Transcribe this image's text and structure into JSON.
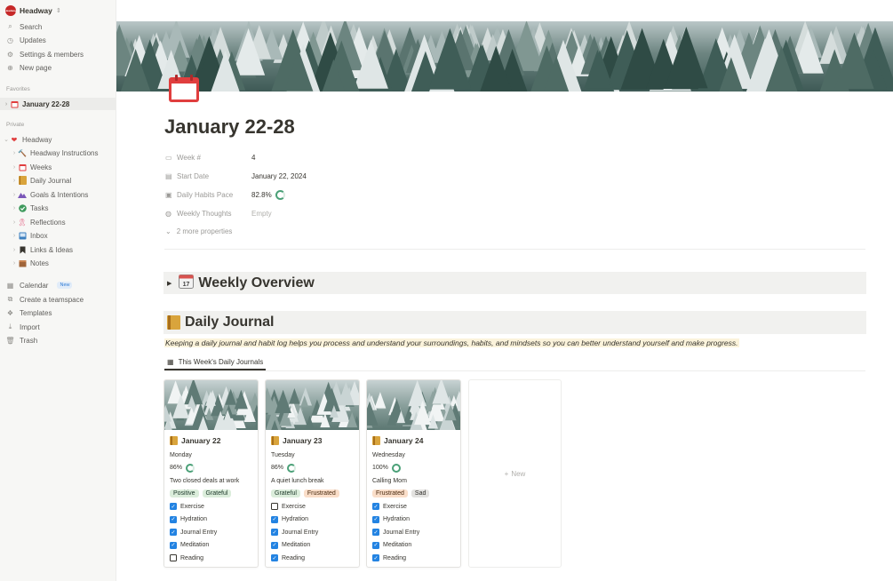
{
  "sidebar": {
    "workspace": "Headway",
    "workspace_logo": "Headway",
    "top": [
      {
        "label": "Search",
        "icon": "search-icon"
      },
      {
        "label": "Updates",
        "icon": "clock-icon"
      },
      {
        "label": "Settings & members",
        "icon": "gear-icon"
      },
      {
        "label": "New page",
        "icon": "plus-circle-icon"
      }
    ],
    "favorites_label": "Favorites",
    "favorites": [
      {
        "label": "January 22-28",
        "icon": "calendar-icon"
      }
    ],
    "private_label": "Private",
    "private_root": {
      "label": "Headway",
      "icon": "heart-icon"
    },
    "private_children": [
      {
        "label": "Headway Instructions",
        "icon": "hammer-icon"
      },
      {
        "label": "Weeks",
        "icon": "calendar-icon"
      },
      {
        "label": "Daily Journal",
        "icon": "journal-icon"
      },
      {
        "label": "Goals & Intentions",
        "icon": "mountain-icon"
      },
      {
        "label": "Tasks",
        "icon": "check-circle-icon"
      },
      {
        "label": "Reflections",
        "icon": "ribbon-icon"
      },
      {
        "label": "Inbox",
        "icon": "inbox-icon"
      },
      {
        "label": "Links & Ideas",
        "icon": "bookmark-icon"
      },
      {
        "label": "Notes",
        "icon": "box-icon"
      }
    ],
    "bottom": [
      {
        "label": "Calendar",
        "icon": "calendar-grid-icon",
        "badge": "New"
      },
      {
        "label": "Create a teamspace",
        "icon": "teamspace-icon"
      },
      {
        "label": "Templates",
        "icon": "templates-icon"
      },
      {
        "label": "Import",
        "icon": "import-icon"
      },
      {
        "label": "Trash",
        "icon": "trash-icon"
      }
    ]
  },
  "page": {
    "title": "January 22-28",
    "properties": [
      {
        "label": "Week #",
        "value": "4",
        "icon": "calendar-icon"
      },
      {
        "label": "Start Date",
        "value": "January 22, 2024",
        "icon": "date-icon"
      },
      {
        "label": "Daily Habits Pace",
        "value": "82.8%",
        "icon": "formula-icon"
      },
      {
        "label": "Weekly Thoughts",
        "value": "Empty",
        "icon": "rollup-icon"
      }
    ],
    "more_properties": "2 more properties",
    "weekly_overview": {
      "title": "Weekly Overview",
      "icon": "calendar-emoji-icon"
    },
    "daily_journal": {
      "title": "Daily Journal",
      "description": "Keeping a daily journal and habit log helps you process and understand your surroundings, habits, and mindsets so you can better understand yourself and make progress.",
      "view_tab": "This Week's Daily Journals",
      "new_label": "New"
    }
  },
  "cards": [
    {
      "title": "January 22",
      "day": "Monday",
      "pct": "86%",
      "pct_value": 0.86,
      "note": "Two closed deals at work",
      "tags": [
        {
          "label": "Positive",
          "bg": "#dbeddb",
          "fg": "#1c3829"
        },
        {
          "label": "Grateful",
          "bg": "#dbeddb",
          "fg": "#1c3829"
        }
      ],
      "habits": [
        {
          "label": "Exercise",
          "checked": true
        },
        {
          "label": "Hydration",
          "checked": true
        },
        {
          "label": "Journal Entry",
          "checked": true
        },
        {
          "label": "Meditation",
          "checked": true
        },
        {
          "label": "Reading",
          "checked": false
        }
      ]
    },
    {
      "title": "January 23",
      "day": "Tuesday",
      "pct": "86%",
      "pct_value": 0.86,
      "note": "A quiet lunch break",
      "tags": [
        {
          "label": "Grateful",
          "bg": "#dbeddb",
          "fg": "#1c3829"
        },
        {
          "label": "Frustrated",
          "bg": "#fadec9",
          "fg": "#49290e"
        }
      ],
      "habits": [
        {
          "label": "Exercise",
          "checked": false
        },
        {
          "label": "Hydration",
          "checked": true
        },
        {
          "label": "Journal Entry",
          "checked": true
        },
        {
          "label": "Meditation",
          "checked": true
        },
        {
          "label": "Reading",
          "checked": true
        }
      ]
    },
    {
      "title": "January 24",
      "day": "Wednesday",
      "pct": "100%",
      "pct_value": 1.0,
      "note": "Calling Mom",
      "tags": [
        {
          "label": "Frustrated",
          "bg": "#fadec9",
          "fg": "#49290e"
        },
        {
          "label": "Sad",
          "bg": "#e3e2e0",
          "fg": "#32302c"
        }
      ],
      "habits": [
        {
          "label": "Exercise",
          "checked": true
        },
        {
          "label": "Hydration",
          "checked": true
        },
        {
          "label": "Journal Entry",
          "checked": true
        },
        {
          "label": "Meditation",
          "checked": true
        },
        {
          "label": "Reading",
          "checked": true
        }
      ]
    }
  ]
}
